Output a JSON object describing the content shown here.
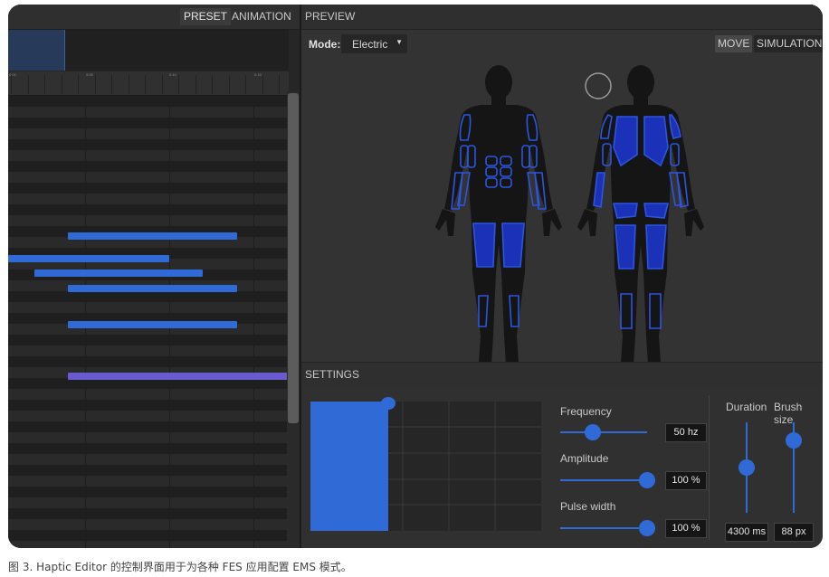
{
  "left_panel": {
    "tabs": [
      {
        "label": "PRESET",
        "active": true
      },
      {
        "label": "ANIMATION",
        "active": false
      }
    ],
    "ruler_labels": [
      "0:00",
      "0:05",
      "0:10",
      "0:15"
    ],
    "timeline_bars": [
      {
        "color": "#2f6ad6"
      },
      {
        "color": "#2f6ad6"
      },
      {
        "color": "#2f6ad6"
      },
      {
        "color": "#2f6ad6"
      },
      {
        "color": "#2f6ad6"
      },
      {
        "color": "#6a5ad0"
      }
    ]
  },
  "preview": {
    "title": "PREVIEW",
    "mode_label": "Mode:",
    "mode_value": "Electric",
    "view_buttons": [
      {
        "label": "MOVE",
        "active": true
      },
      {
        "label": "SIMULATION",
        "active": false
      }
    ]
  },
  "settings": {
    "title": "SETTINGS",
    "frequency": {
      "label": "Frequency",
      "value": "50 hz",
      "level": 0.38
    },
    "amplitude": {
      "label": "Amplitude",
      "value": "100 %",
      "level": 1.0
    },
    "pulse_width": {
      "label": "Pulse width",
      "value": "100 %",
      "level": 1.0
    },
    "duration": {
      "label": "Duration",
      "value": "4300 ms",
      "level": 0.5
    },
    "brush_size": {
      "label": "Brush size",
      "value": "88 px",
      "level": 0.8
    }
  },
  "colors": {
    "accent": "#2f6ad6",
    "muscle_fill": "#1b32b8",
    "muscle_outline": "#2c55e0",
    "purple_bar": "#6a5ad0"
  },
  "caption": "图 3. Haptic Editor 的控制界面用于为各种 FES 应用配置 EMS 模式。"
}
